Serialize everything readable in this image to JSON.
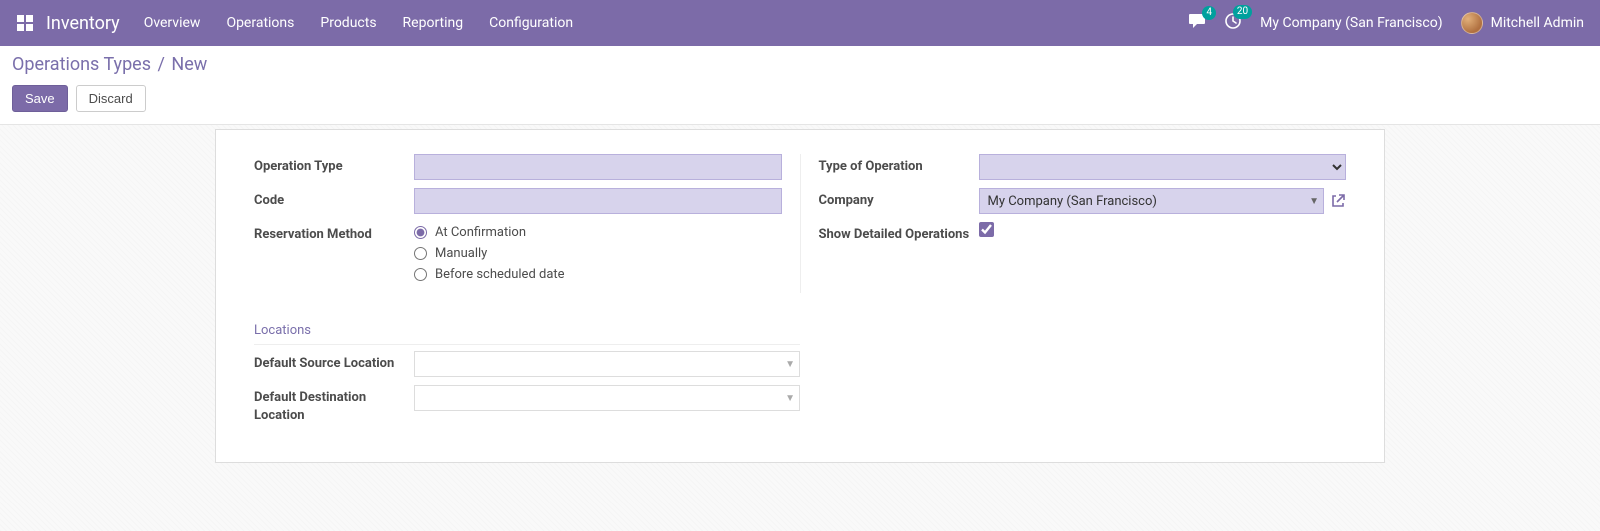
{
  "navbar": {
    "brand": "Inventory",
    "menu": [
      "Overview",
      "Operations",
      "Products",
      "Reporting",
      "Configuration"
    ],
    "messages_badge": "4",
    "activities_badge": "20",
    "company": "My Company (San Francisco)",
    "username": "Mitchell Admin"
  },
  "breadcrumb": {
    "parent": "Operations Types",
    "current": "New"
  },
  "buttons": {
    "save": "Save",
    "discard": "Discard"
  },
  "form": {
    "left": {
      "operation_type_label": "Operation Type",
      "operation_type_value": "",
      "code_label": "Code",
      "code_value": "",
      "reservation_method_label": "Reservation Method",
      "reservation_options": {
        "at_confirmation": "At Confirmation",
        "manually": "Manually",
        "before_scheduled": "Before scheduled date"
      },
      "reservation_selected": "at_confirmation"
    },
    "right": {
      "type_of_operation_label": "Type of Operation",
      "type_of_operation_value": "",
      "company_label": "Company",
      "company_value": "My Company (San Francisco)",
      "show_detailed_label": "Show Detailed Operations",
      "show_detailed_checked": true
    },
    "locations": {
      "section_title": "Locations",
      "default_source_label": "Default Source Location",
      "default_source_value": "",
      "default_destination_label": "Default Destination Location",
      "default_destination_value": ""
    }
  }
}
